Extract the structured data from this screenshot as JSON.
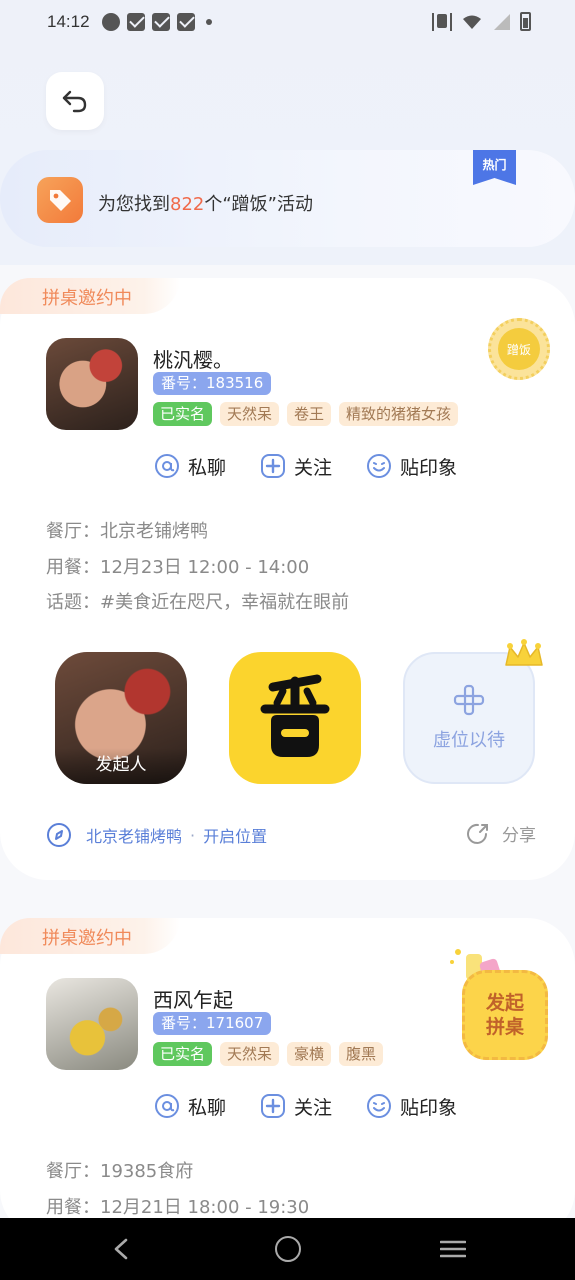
{
  "status_bar": {
    "time": "14:12"
  },
  "banner": {
    "prefix": "为您找到",
    "count": "822",
    "suffix": "个“蹭饭”活动",
    "ribbon": "热门"
  },
  "cards": [
    {
      "tag": "拼桌邀约中",
      "name": "桃汎樱。",
      "id_label": "番号：183516",
      "verified": "已实名",
      "tags": [
        "天然呆",
        "卷王",
        "精致的猪猪女孩"
      ],
      "stamp": "蹭饭",
      "actions": {
        "chat": "私聊",
        "follow": "关注",
        "impression": "贴印象"
      },
      "restaurant": "餐厅：北京老铺烤鸭",
      "time": "用餐：12月23日 12:00 - 14:00",
      "topic": "话题：#美食近在咫尺，幸福就在眼前",
      "seats": {
        "initiator": "发起人",
        "vacant": "虚位以待"
      },
      "location": {
        "name": "北京老铺烤鸭",
        "sep": "·",
        "enable": "开启位置"
      },
      "share": "分享"
    },
    {
      "tag": "拼桌邀约中",
      "name": "西风乍起",
      "id_label": "番号：171607",
      "verified": "已实名",
      "tags": [
        "天然呆",
        "豪横",
        "腹黑"
      ],
      "actions": {
        "chat": "私聊",
        "follow": "关注",
        "impression": "贴印象"
      },
      "restaurant": "餐厅：19385食府",
      "time": "用餐：12月21日 18:00 - 19:30"
    }
  ],
  "float_button": {
    "line1": "发起",
    "line2": "拼桌"
  },
  "colors": {
    "accent": "#5a7fd8",
    "count": "#f06a4b",
    "verified": "#5fc85e",
    "brand_yellow": "#fbd42d"
  },
  "icons": [
    "back-arrow-icon",
    "price-tag-icon",
    "at-icon",
    "plus-circle-icon",
    "smile-icon",
    "location-icon",
    "share-icon",
    "crown-icon",
    "nav-back-icon",
    "nav-home-icon",
    "nav-menu-icon"
  ]
}
